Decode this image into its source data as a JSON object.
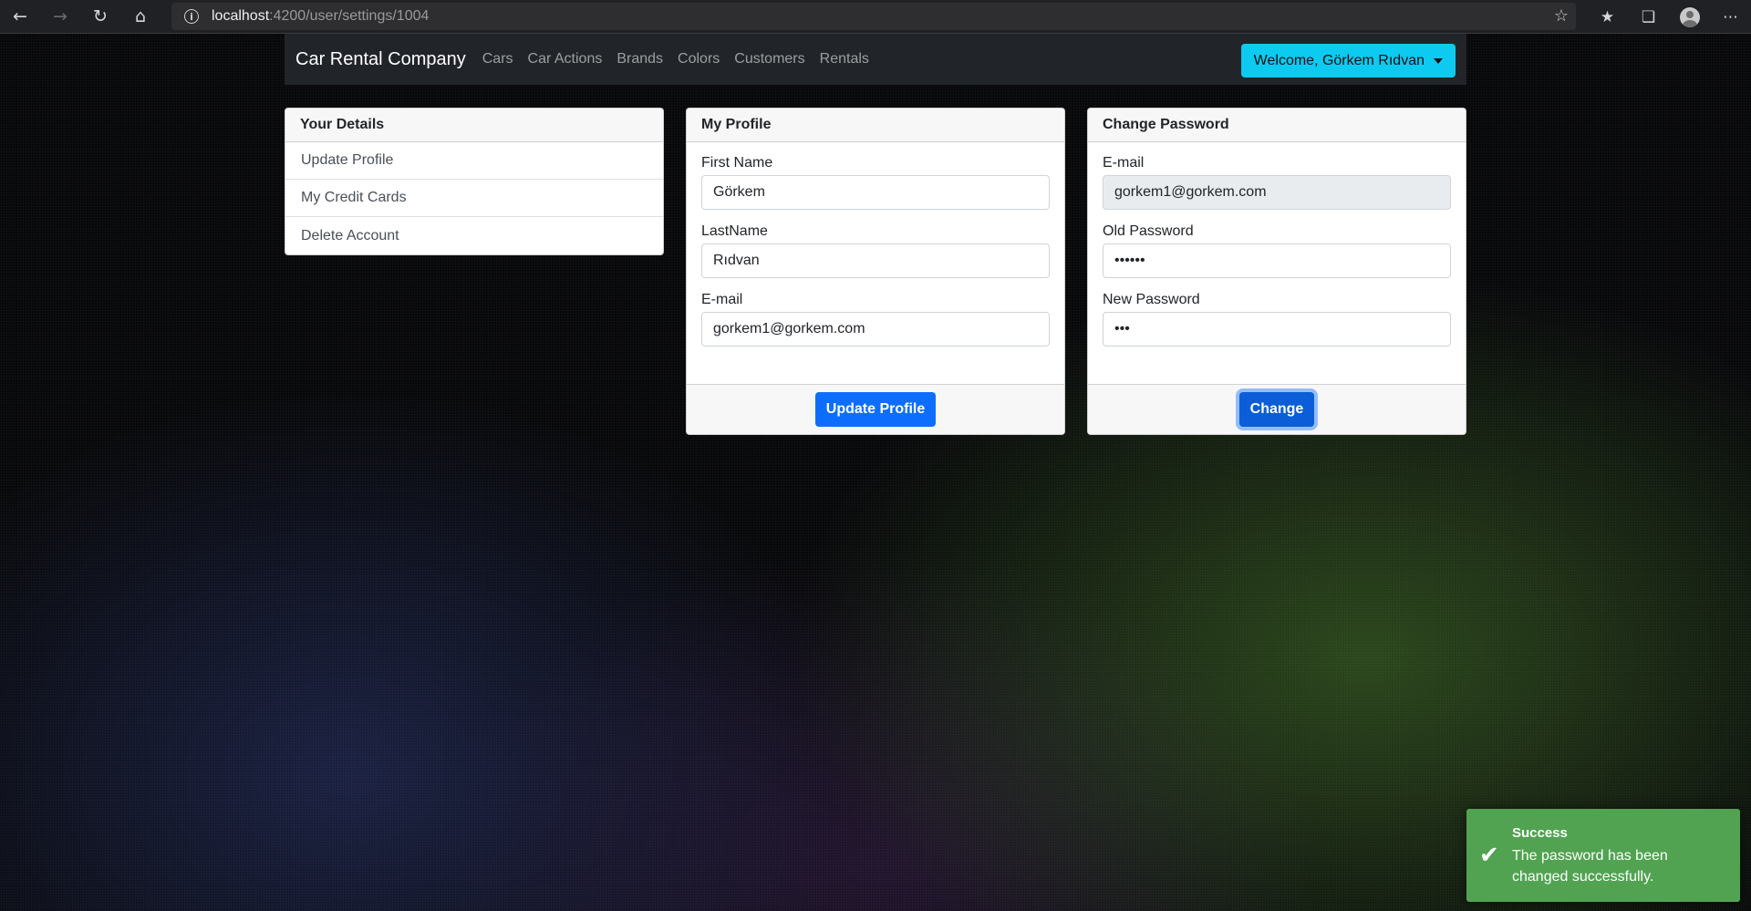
{
  "browser": {
    "url_host": "localhost",
    "url_path": ":4200/user/settings/1004"
  },
  "navbar": {
    "brand": "Car Rental Company",
    "links": [
      "Cars",
      "Car Actions",
      "Brands",
      "Colors",
      "Customers",
      "Rentals"
    ],
    "welcome": "Welcome, Görkem Rıdvan"
  },
  "details_card": {
    "title": "Your Details",
    "items": [
      "Update Profile",
      "My Credit Cards",
      "Delete Account"
    ]
  },
  "profile_card": {
    "title": "My Profile",
    "first_name_label": "First Name",
    "first_name_value": "Görkem",
    "last_name_label": "LastName",
    "last_name_value": "Rıdvan",
    "email_label": "E-mail",
    "email_value": "gorkem1@gorkem.com",
    "button": "Update Profile"
  },
  "password_card": {
    "title": "Change Password",
    "email_label": "E-mail",
    "email_value": "gorkem1@gorkem.com",
    "old_password_label": "Old Password",
    "old_password_value": "••••••",
    "new_password_label": "New Password",
    "new_password_value": "•••",
    "button": "Change"
  },
  "toast": {
    "title": "Success",
    "message": "The password has been changed successfully."
  }
}
